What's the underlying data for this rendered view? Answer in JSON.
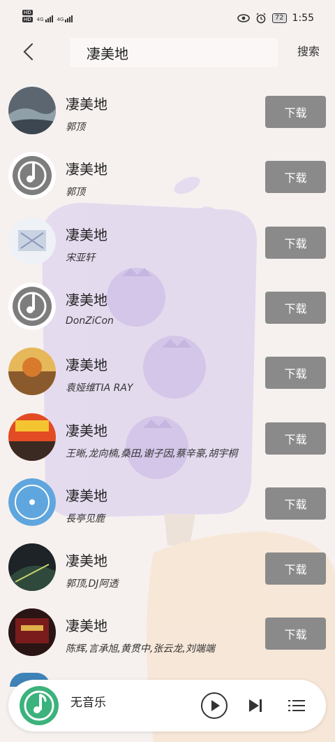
{
  "status_bar": {
    "network": "4G",
    "hd_tags": [
      "HD",
      "HD"
    ],
    "battery": "72",
    "time": "1:55"
  },
  "header": {
    "query": "凄美地",
    "search_label": "搜索"
  },
  "songs": [
    {
      "title": "凄美地",
      "artist": "郭顶",
      "download_label": "下载",
      "cover": "photo-cover"
    },
    {
      "title": "凄美地",
      "artist": "郭顶",
      "download_label": "下载",
      "cover": "default-disc"
    },
    {
      "title": "凄美地",
      "artist": "宋亚轩",
      "download_label": "下载",
      "cover": "photo-cover"
    },
    {
      "title": "凄美地",
      "artist": "DonZiCon",
      "download_label": "下载",
      "cover": "default-disc"
    },
    {
      "title": "凄美地",
      "artist": "袁娅维TIA RAY",
      "download_label": "下载",
      "cover": "photo-cover"
    },
    {
      "title": "凄美地",
      "artist": "王晰,龙向楠,桑田,谢子因,蔡辛豪,胡宇桐",
      "download_label": "下载",
      "cover": "photo-cover"
    },
    {
      "title": "凄美地",
      "artist": "長亭见鹿",
      "download_label": "下载",
      "cover": "blue-disc"
    },
    {
      "title": "凄美地",
      "artist": "郭顶,DJ阿透",
      "download_label": "下载",
      "cover": "photo-cover"
    },
    {
      "title": "凄美地",
      "artist": "陈辉,言承旭,黄贯中,张云龙,刘端端",
      "download_label": "下载",
      "cover": "photo-cover"
    }
  ],
  "player": {
    "title": "无音乐",
    "accent": "#3cb27c"
  },
  "colors": {
    "download_button": "#8a8a8a",
    "background": "#f6f1ef"
  }
}
